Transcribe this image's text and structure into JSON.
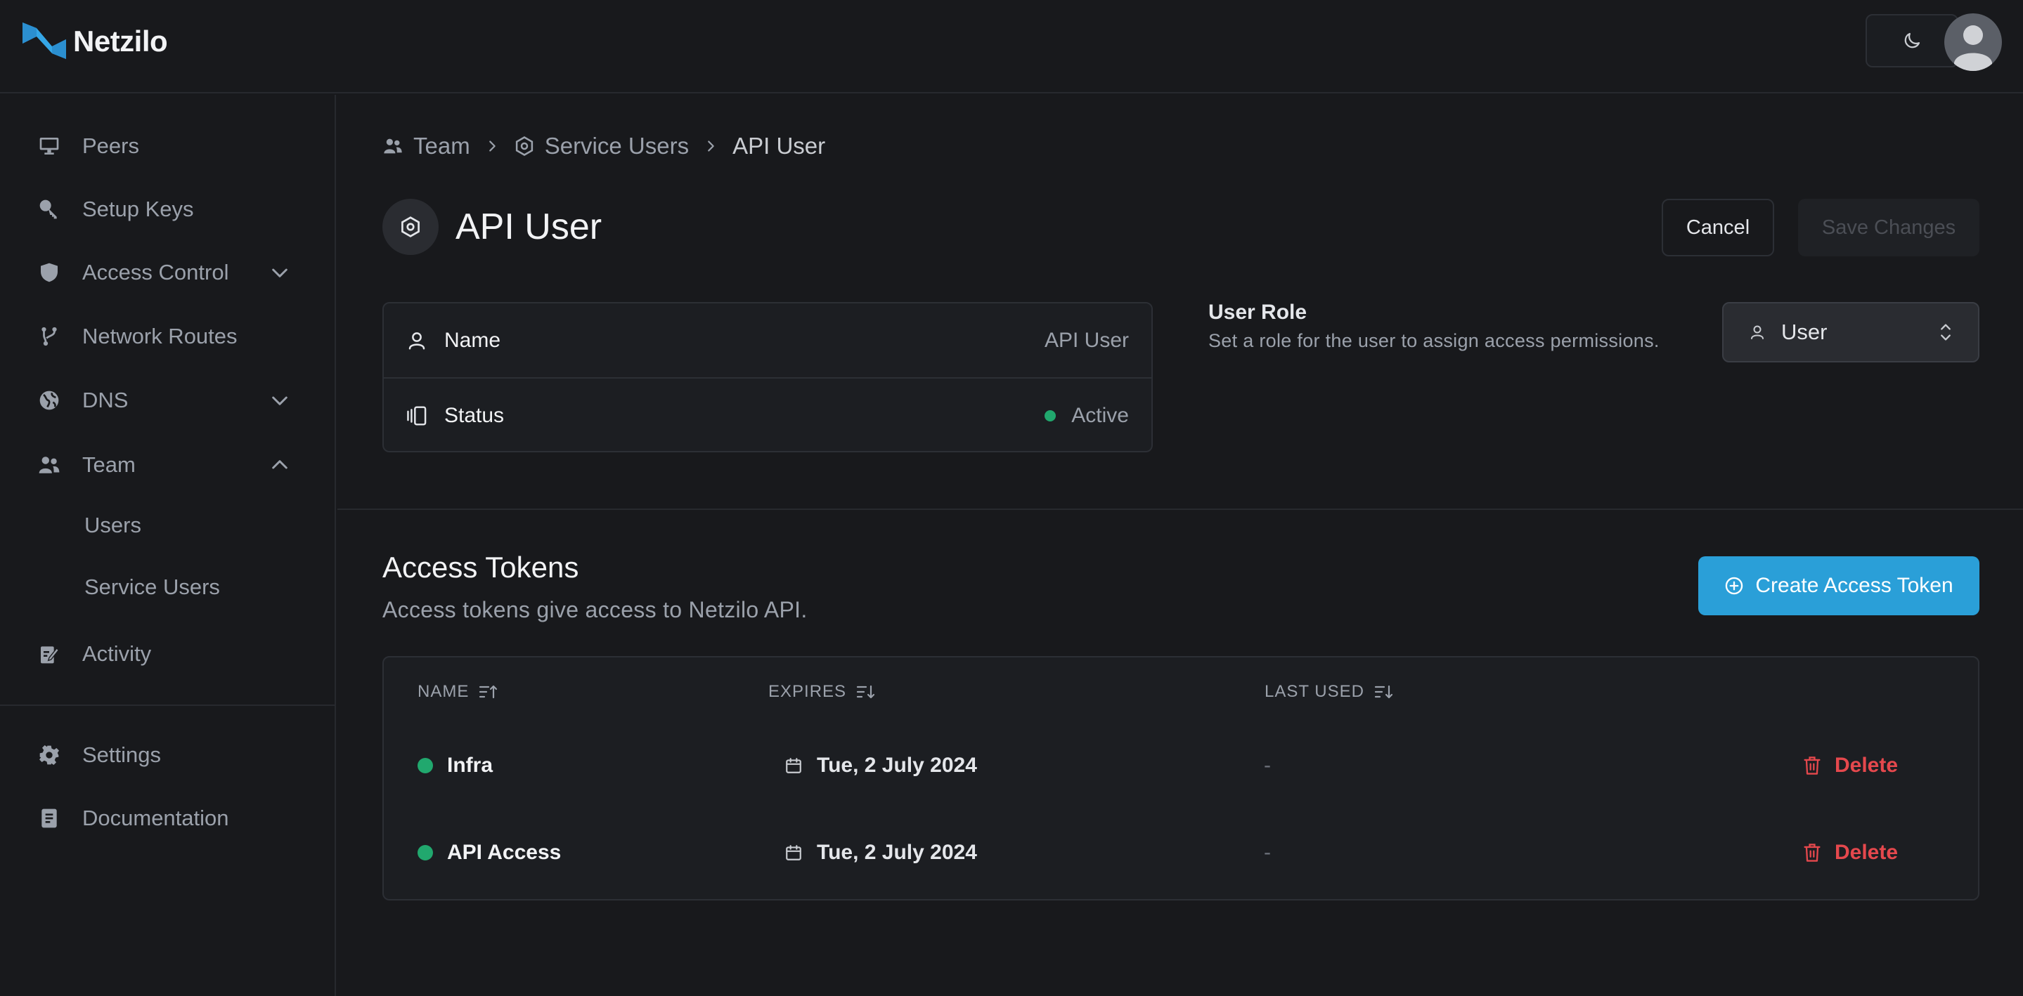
{
  "app": {
    "name": "Netzilo"
  },
  "sidebar": {
    "items": [
      {
        "label": "Peers",
        "icon": "monitor-icon"
      },
      {
        "label": "Setup Keys",
        "icon": "key-icon"
      },
      {
        "label": "Access Control",
        "icon": "shield-icon"
      },
      {
        "label": "Network Routes",
        "icon": "route-icon"
      },
      {
        "label": "DNS",
        "icon": "globe-icon"
      },
      {
        "label": "Team",
        "icon": "users-icon"
      },
      {
        "label": "Users"
      },
      {
        "label": "Service Users"
      },
      {
        "label": "Activity",
        "icon": "activity-icon"
      },
      {
        "label": "Settings",
        "icon": "gear-icon"
      },
      {
        "label": "Documentation",
        "icon": "book-icon"
      }
    ]
  },
  "breadcrumb": {
    "team": "Team",
    "service_users": "Service Users",
    "current": "API User"
  },
  "page": {
    "title": "API User",
    "cancel_label": "Cancel",
    "save_label": "Save Changes"
  },
  "info": {
    "name_label": "Name",
    "name_value": "API User",
    "status_label": "Status",
    "status_value": "Active"
  },
  "role": {
    "title": "User Role",
    "description": "Set a role for the user to assign access permissions.",
    "selected": "User"
  },
  "tokens": {
    "title": "Access Tokens",
    "description": "Access tokens give access to Netzilo API.",
    "create_label": "Create Access Token",
    "columns": {
      "name": "NAME",
      "expires": "EXPIRES",
      "last_used": "LAST USED"
    },
    "rows": [
      {
        "name": "Infra",
        "expires": "Tue, 2 July 2024",
        "last_used": "-",
        "action": "Delete"
      },
      {
        "name": "API Access",
        "expires": "Tue, 2 July 2024",
        "last_used": "-",
        "action": "Delete"
      }
    ]
  },
  "colors": {
    "background": "#18191c",
    "accent": "#2a9fd8",
    "status_active": "#21a86e",
    "danger": "#e5484d"
  }
}
